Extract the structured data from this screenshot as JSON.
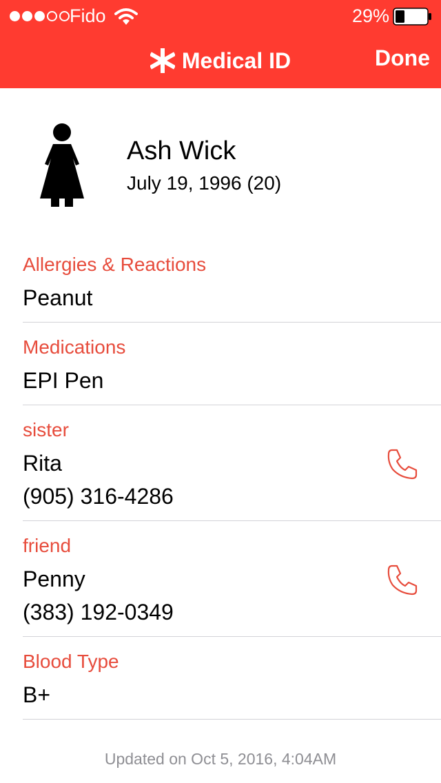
{
  "status_bar": {
    "carrier": "Fido",
    "battery_percent": "29%",
    "battery_level": 0.29,
    "signal_bars_filled": 3,
    "signal_bars_total": 5,
    "icons": [
      "wifi-icon",
      "battery-icon"
    ]
  },
  "nav": {
    "title": "Medical ID",
    "done_label": "Done",
    "icon": "asterisk-icon"
  },
  "profile": {
    "name": "Ash Wick",
    "dob": "July 19, 1996 (20)",
    "icon": "person-icon"
  },
  "sections": {
    "allergies": {
      "label": "Allergies & Reactions",
      "value": "Peanut"
    },
    "medications": {
      "label": "Medications",
      "value": "EPI Pen"
    },
    "contacts": [
      {
        "relationship": "sister",
        "name": "Rita",
        "phone": "(905) 316-4286"
      },
      {
        "relationship": "friend",
        "name": "Penny",
        "phone": "(383) 192-0349"
      }
    ],
    "blood_type": {
      "label": "Blood Type",
      "value": "B+"
    }
  },
  "footer": {
    "updated": "Updated on Oct 5, 2016, 4:04AM"
  },
  "colors": {
    "header_bg": "#ff3b30",
    "label_red": "#e74c3c",
    "divider": "#d2d2d7",
    "footer_gray": "#8e8e93"
  }
}
